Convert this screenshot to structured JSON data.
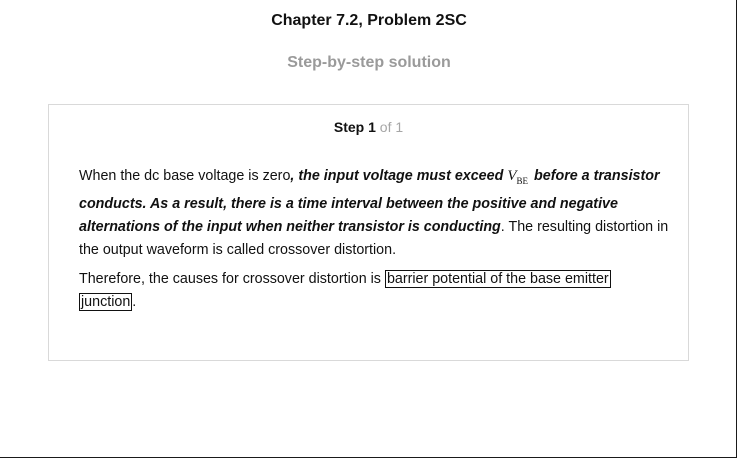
{
  "header": {
    "chapter_title": "Chapter 7.2, Problem 2SC",
    "subtitle": "Step-by-step solution"
  },
  "step": {
    "word": "Step",
    "number": "1",
    "of_text": "of 1",
    "paragraph1": {
      "intro": "When the dc base voltage is zero",
      "emphasis_a": ", the input voltage must exceed",
      "math_var": "V",
      "math_sub": "BE",
      "emphasis_b": "before a transistor conducts. As a result, there is a time interval between the positive and negative alternations of the input when neither transistor is conducting",
      "outro": ". The resulting distortion in the output waveform is called crossover distortion."
    },
    "paragraph2": {
      "intro": "Therefore, the causes for crossover distortion is ",
      "answer_line1": "barrier potential of the base emitter",
      "answer_line2": "junction",
      "outro": "."
    }
  }
}
